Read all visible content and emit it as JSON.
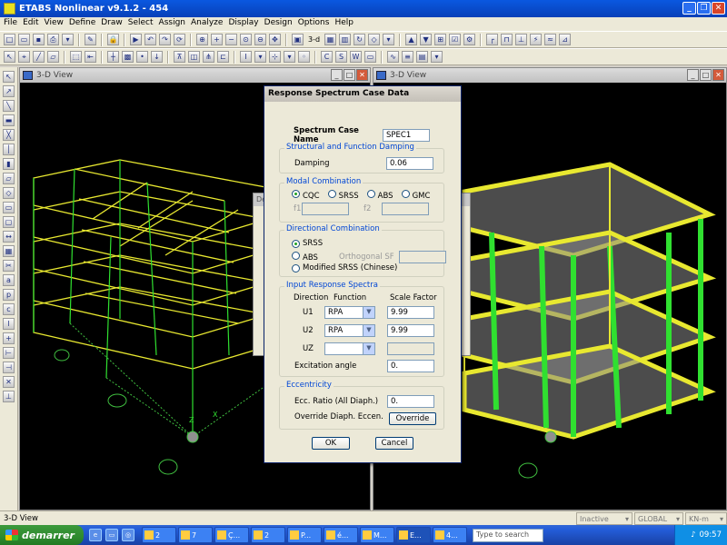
{
  "app": {
    "title": "ETABS Nonlinear v9.1.2 - 454"
  },
  "menu": [
    "File",
    "Edit",
    "View",
    "Define",
    "Draw",
    "Select",
    "Assign",
    "Analyze",
    "Display",
    "Design",
    "Options",
    "Help"
  ],
  "toolbar": {
    "view3d_label": "3-d"
  },
  "panes": {
    "left_title": "3-D View",
    "right_title": "3-D View"
  },
  "dialog": {
    "title": "Response Spectrum Case Data",
    "case_name_label": "Spectrum Case Name",
    "case_name_value": "SPEC1",
    "damping_group": "Structural and Function Damping",
    "damping_label": "Damping",
    "damping_value": "0.06",
    "modal_group": "Modal Combination",
    "modal_options": [
      "CQC",
      "SRSS",
      "ABS",
      "GMC"
    ],
    "modal_selected": "CQC",
    "f1_label": "f1",
    "f2_label": "f2",
    "directional_group": "Directional Combination",
    "dir_options": [
      "SRSS",
      "ABS",
      "Modified SRSS (Chinese)"
    ],
    "dir_selected": "SRSS",
    "orth_sf_label": "Orthogonal SF",
    "input_group": "Input Response Spectra",
    "col_direction": "Direction",
    "col_function": "Function",
    "col_scale": "Scale Factor",
    "rows": [
      {
        "dir": "U1",
        "func": "RPA",
        "scale": "9.99"
      },
      {
        "dir": "U2",
        "func": "RPA",
        "scale": "9.99"
      },
      {
        "dir": "UZ",
        "func": "",
        "scale": ""
      }
    ],
    "excitation_label": "Excitation angle",
    "excitation_value": "0.",
    "ecc_group": "Eccentricity",
    "ecc_ratio_label": "Ecc. Ratio (All Diaph.)",
    "ecc_ratio_value": "0.",
    "override_label": "Override Diaph. Eccen.",
    "override_button": "Override",
    "ok_button": "OK",
    "cancel_button": "Cancel"
  },
  "behind_dialog": {
    "title": "De"
  },
  "status": {
    "text": "3-D View",
    "field1": "Inactive",
    "field2": "GLOBAL",
    "field3": "KN-m"
  },
  "taskbar": {
    "start_label": "demarrer",
    "tasks": [
      "2",
      "7",
      "Ç...",
      "2",
      "P...",
      "é...",
      "M...",
      "E...",
      "4..."
    ],
    "search_placeholder": "Type to search",
    "clock": "09:57"
  },
  "colors": {
    "frame_yellow": "#e8e830",
    "frame_green": "#30e030",
    "accent_blue": "#0a58e0"
  }
}
